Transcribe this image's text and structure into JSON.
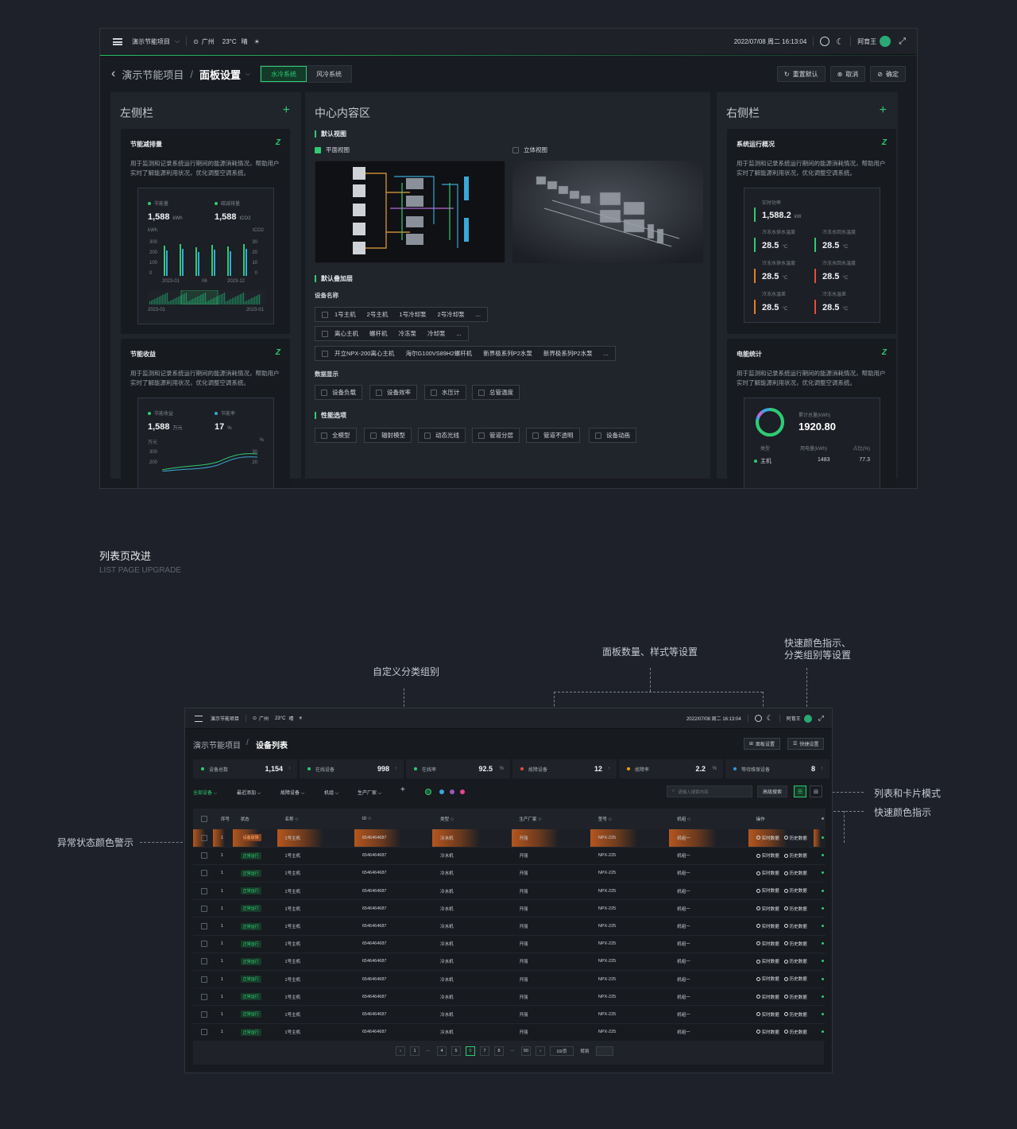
{
  "screen1": {
    "topbar": {
      "project": "演示节能项目",
      "city": "广州",
      "temp": "23°C",
      "weather": "晴",
      "datetime": "2022/07/08  周二  16:13:04",
      "user": "阿育王"
    },
    "header": {
      "breadcrumb_root": "演示节能项目",
      "title": "面板设置",
      "tabs": [
        "水冷系统",
        "风冷系统"
      ],
      "reset": "重置默认",
      "cancel": "取消",
      "confirm": "确定"
    },
    "left": {
      "title": "左侧栏",
      "card1": {
        "title": "节能减排量",
        "desc": "用于监测和记录系统运行期间的能源消耗情况，帮助用户实时了解能源利用状况，优化调整空调系统。",
        "m1_label": "节能量",
        "m1_value": "1,588",
        "m1_unit": "kWh",
        "m2_label": "碳减排量",
        "m2_value": "1,588",
        "m2_unit": "tCO2",
        "yl": "kWh",
        "yr": "tCO2",
        "yticks": [
          "300",
          "200",
          "100",
          "0"
        ],
        "yticks_r": [
          "30",
          "20",
          "10",
          "0"
        ],
        "x_labels": [
          "2023-01",
          "06",
          "2023-12"
        ],
        "range": [
          "2023-01",
          "2023-01"
        ]
      },
      "card2": {
        "title": "节能收益",
        "desc": "用于监测和记录系统运行期间的能源消耗情况，帮助用户实时了解能源利用状况，优化调整空调系统。",
        "m1_label": "节能收益",
        "m1_value": "1,588",
        "m1_unit": "万元",
        "m2_label": "节能率",
        "m2_value": "17",
        "m2_unit": "%",
        "yl": "万元",
        "yr": "%",
        "yticks": [
          "300",
          "200"
        ],
        "yticks_r": [
          "30",
          "20"
        ]
      }
    },
    "center": {
      "title": "中心内容区",
      "view_title": "默认视图",
      "view1": "平面视图",
      "view2": "立体视图",
      "layer_title": "默认叠加层",
      "device_label": "设备名称",
      "devices_row1": [
        "1号主机",
        "2号主机",
        "1号冷却泵",
        "2号冷却泵",
        "..."
      ],
      "devices_row2": [
        "离心主机",
        "螺杆机",
        "冷冻泵",
        "冷却泵",
        "..."
      ],
      "devices_row3": [
        "开立NPX-200离心主机",
        "海尔G100VS89H2螺杆机",
        "新界极系列P2水泵",
        "新界极系列P2水泵",
        "..."
      ],
      "data_label": "数据显示",
      "data_opts": [
        "设备负载",
        "设备效率",
        "水压计",
        "总管温度"
      ],
      "perf_title": "性能选项",
      "perf_opts": [
        "全模型",
        "辐射模型",
        "动态光线",
        "管道分层",
        "管道不透明",
        "设备动画"
      ]
    },
    "right": {
      "title": "右侧栏",
      "card1": {
        "title": "系统运行概况",
        "desc": "用于监测和记录系统运行期间的能源消耗情况，帮助用户实时了解能源利用状况，优化调整空调系统。",
        "power_label": "实时功率",
        "power_value": "1,588.2",
        "power_unit": "kW",
        "items": [
          {
            "label": "冷冻水供水温度",
            "value": "28.5",
            "unit": "°C"
          },
          {
            "label": "冷冻水回水温度",
            "value": "28.5",
            "unit": "°C"
          },
          {
            "label": "冷冻水供水温度",
            "value": "28.5",
            "unit": "°C"
          },
          {
            "label": "冷冻水回水温度",
            "value": "28.5",
            "unit": "°C"
          },
          {
            "label": "冷冻水温差",
            "value": "28.5",
            "unit": "°C"
          },
          {
            "label": "冷冻水温差",
            "value": "28.5",
            "unit": "°C"
          }
        ]
      },
      "card2": {
        "title": "电能统计",
        "desc": "用于监测和记录系统运行期间的能源消耗情况，帮助用户实时了解能源利用状况，优化调整空调系统。",
        "total_label": "累计总量(kWh)",
        "total_value": "1920.80",
        "col1": "类型",
        "col2": "用电量(kWh)",
        "col3": "占比(%)",
        "row_type": "主机",
        "row_value": "1483",
        "row_pct": "77.3"
      }
    }
  },
  "section": {
    "title": "列表页改进",
    "subtitle": "LIST PAGE UPGRADE"
  },
  "annotations": {
    "a1": "自定义分类组别",
    "a2": "面板数量、样式等设置",
    "a3": "快速颜色指示、",
    "a3b": "分类组别等设置",
    "a4": "列表和卡片模式",
    "a5": "快速颜色指示",
    "a6": "异常状态颜色警示"
  },
  "screen2": {
    "topbar": {
      "project": "演示节能项目",
      "city": "广州",
      "temp": "23°C",
      "weather": "晴",
      "datetime": "2022/07/08  周二  16:13:04",
      "user": "阿育王"
    },
    "header": {
      "root": "演示节能项目",
      "title": "设备列表",
      "panel_btn": "面板设置",
      "quick_btn": "快捷设置"
    },
    "stats": [
      {
        "label": "设备总数",
        "value": "1,154",
        "color": "#2ecc71"
      },
      {
        "label": "在线设备",
        "value": "998",
        "color": "#2ecc71"
      },
      {
        "label": "在线率",
        "value": "92.5",
        "unit": "%",
        "color": "#2ecc71"
      },
      {
        "label": "故障设备",
        "value": "12",
        "color": "#e74c3c"
      },
      {
        "label": "故障率",
        "value": "2.2",
        "unit": "%",
        "color": "#f39c12"
      },
      {
        "label": "等待维保设备",
        "value": "8",
        "color": "#3498db"
      }
    ],
    "filters": [
      "全部设备",
      "最近添加",
      "故障设备",
      "机组",
      "生产厂家"
    ],
    "search_placeholder": "请输入搜索内容",
    "adv_search": "高级搜索",
    "columns": [
      "序号",
      "状态",
      "名称",
      "ID",
      "类型",
      "生产厂家",
      "型号",
      "机组",
      "操作"
    ],
    "row": {
      "idx": "1",
      "status_ok": "正常运行",
      "status_bad": "设备故障",
      "name": "1号主机",
      "id": "6546464687",
      "type": "冷水机",
      "maker": "开丽",
      "model": "NPX-225",
      "group": "机组一",
      "op1": "实时数据",
      "op2": "历史数据"
    },
    "pager": {
      "pages": [
        "1",
        "4",
        "5",
        "6",
        "7",
        "8",
        "50"
      ],
      "current": "6",
      "size": "10/页",
      "goto": "转到"
    }
  }
}
